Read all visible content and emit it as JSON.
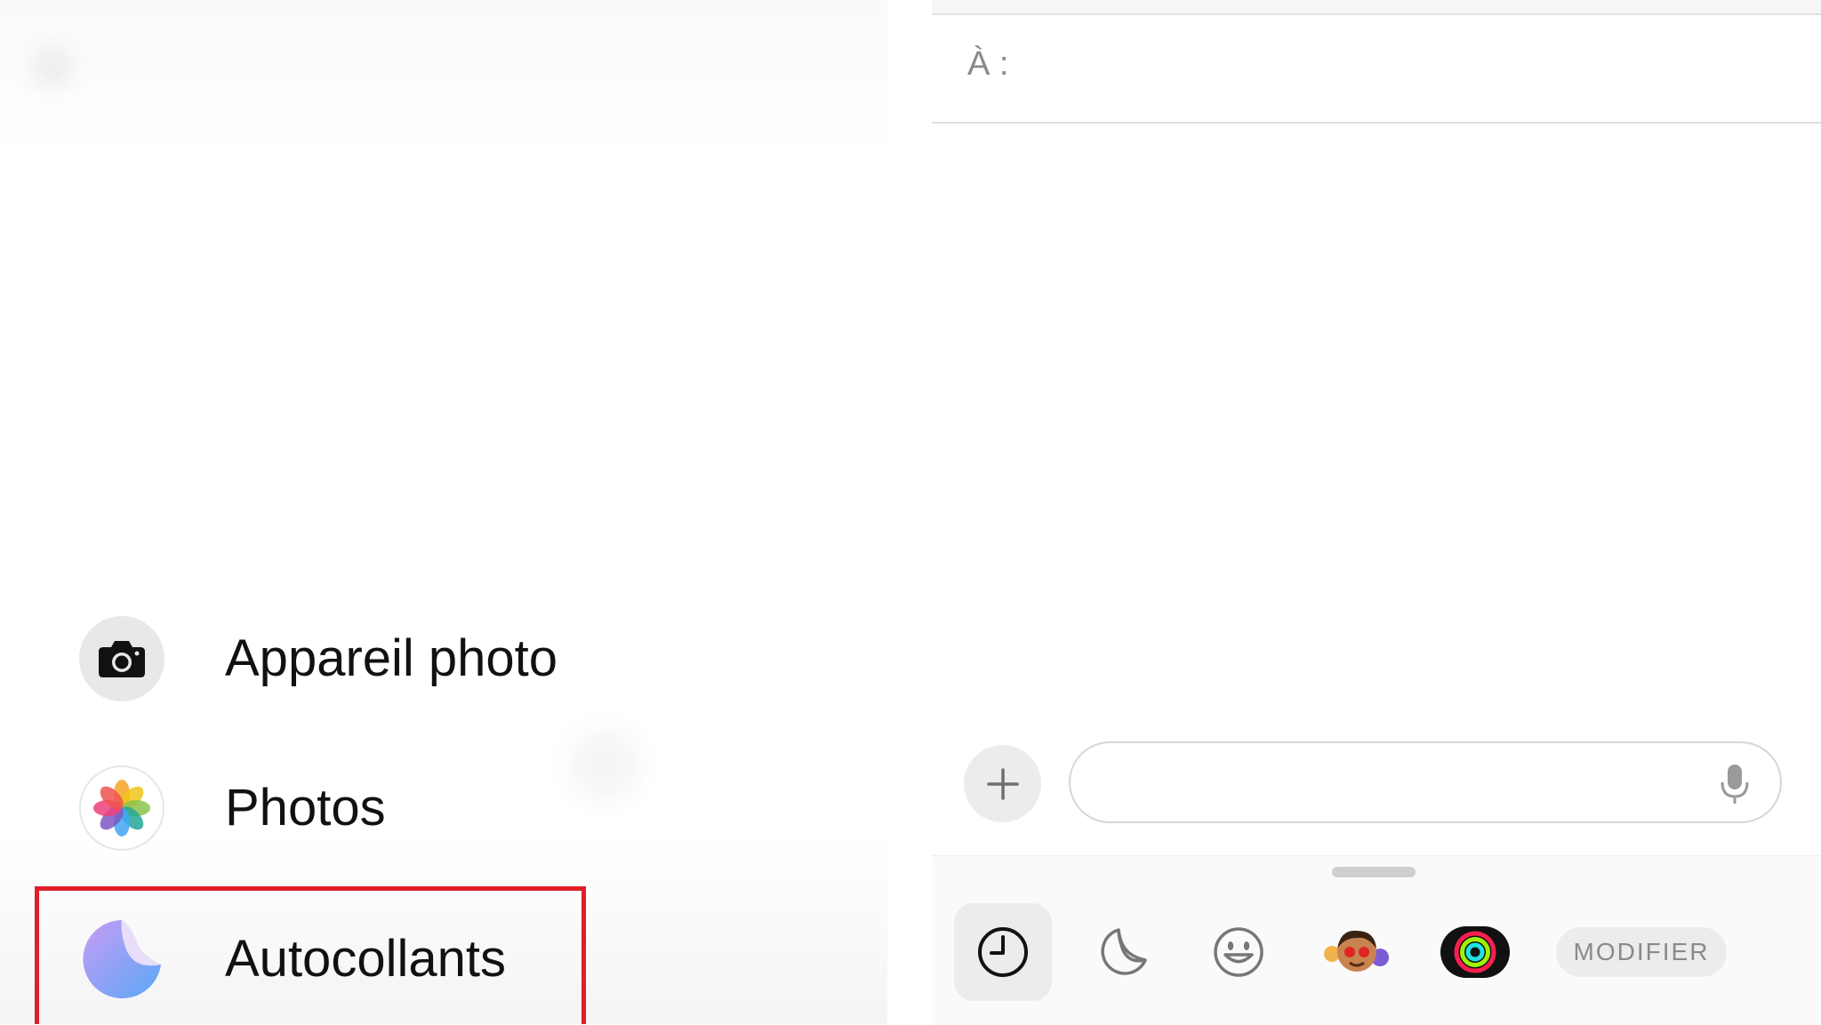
{
  "left_menu": {
    "items": [
      {
        "label": "Appareil photo",
        "icon": "camera-icon"
      },
      {
        "label": "Photos",
        "icon": "photos-app-icon"
      },
      {
        "label": "Autocollants",
        "icon": "stickers-app-icon"
      }
    ],
    "highlighted_item": "Autocollants",
    "highlight_color": "#e11d2a"
  },
  "compose": {
    "to_label": "À :",
    "message_placeholder": ""
  },
  "app_tray": {
    "buttons": [
      "recents-icon",
      "stickers-icon",
      "emoji-icon",
      "memoji-icon",
      "activity-rings-icon"
    ],
    "modifier_label": "MODIFIER"
  }
}
